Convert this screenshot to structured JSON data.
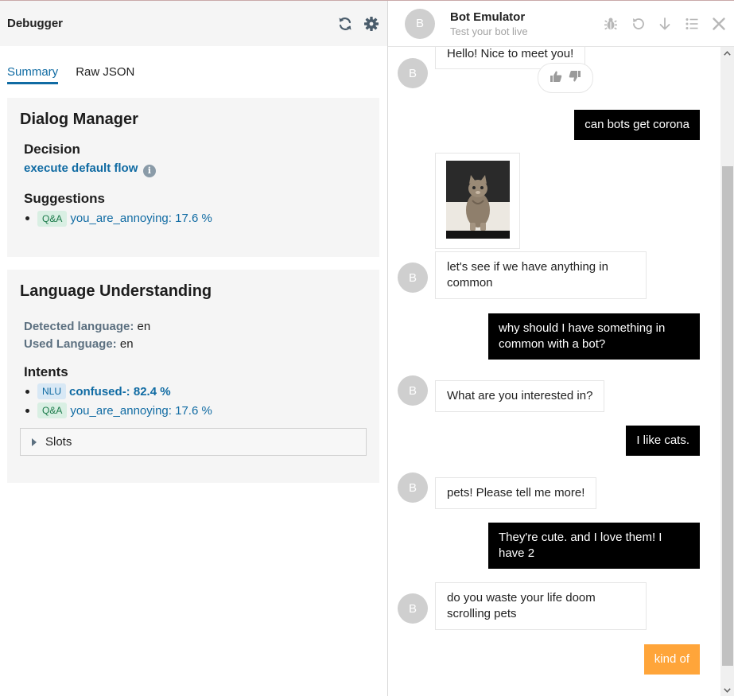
{
  "debugger": {
    "title": "Debugger",
    "tabs": [
      {
        "label": "Summary"
      },
      {
        "label": "Raw JSON"
      }
    ],
    "dialog_manager": {
      "title": "Dialog Manager",
      "decision_label": "Decision",
      "decision_value": "execute default flow",
      "suggestions_label": "Suggestions",
      "suggestions": [
        {
          "tag": "Q&A",
          "text": "you_are_annoying: 17.6 %"
        }
      ]
    },
    "language_understanding": {
      "title": "Language Understanding",
      "detected_label": "Detected language:",
      "detected_value": "en",
      "used_label": "Used Language:",
      "used_value": "en",
      "intents_label": "Intents",
      "intents": [
        {
          "tag": "NLU",
          "text": "confused-: 82.4 %"
        },
        {
          "tag": "Q&A",
          "text": "you_are_annoying: 17.6 %"
        }
      ],
      "slots_label": "Slots"
    }
  },
  "emulator": {
    "avatar_letter": "B",
    "title": "Bot Emulator",
    "subtitle": "Test your bot live",
    "messages": [
      {
        "from": "bot",
        "text": "Hello! Nice to meet you!"
      },
      {
        "from": "user",
        "text": "can bots get corona"
      },
      {
        "from": "bot",
        "text": "let's see if we have anything in common"
      },
      {
        "from": "user",
        "text": "why should I have something in common with a bot?"
      },
      {
        "from": "bot",
        "text": "What are you interested in?"
      },
      {
        "from": "user",
        "text": "I like cats."
      },
      {
        "from": "bot",
        "text": "pets! Please tell me more!"
      },
      {
        "from": "user",
        "text": "They're cute. and I love them! I have 2"
      },
      {
        "from": "bot",
        "text": "do you waste your life doom scrolling pets"
      },
      {
        "from": "user",
        "text": "kind of"
      }
    ]
  }
}
